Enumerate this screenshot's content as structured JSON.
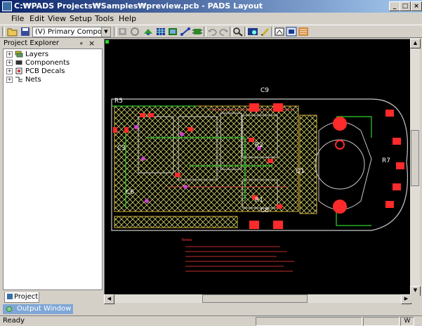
{
  "window": {
    "title": "C:₩PADS Projects₩Samples₩preview.pcb - PADS Layout",
    "controls": {
      "minimize": "_",
      "maximize": "□",
      "close": "×"
    }
  },
  "menu": [
    "File",
    "Edit",
    "View",
    "Setup",
    "Tools",
    "Help"
  ],
  "toolbar": {
    "mode_select": "(V) Primary Componen",
    "icons": [
      "open-icon",
      "save-icon",
      "select-mode-icon",
      "refresh-icon",
      "pan-icon",
      "grid-icon",
      "components-icon",
      "route-icon",
      "drc-icon",
      "undo-icon",
      "redo-icon",
      "zoom-icon",
      "view-icon",
      "highlight-icon",
      "cam-icon",
      "board-icon",
      "window-icon"
    ]
  },
  "explorer": {
    "title": "Project Explorer",
    "pin": "ᵩ",
    "close": "×",
    "items": [
      {
        "label": "Layers",
        "icon": "layers-icon"
      },
      {
        "label": "Components",
        "icon": "components-icon"
      },
      {
        "label": "PCB Decals",
        "icon": "decals-icon"
      },
      {
        "label": "Nets",
        "icon": "nets-icon"
      }
    ],
    "tab": "Project"
  },
  "canvas": {
    "labels": [
      "R5",
      "C9",
      "C3",
      "R2",
      "C6",
      "R1",
      "C8",
      "R7",
      "Q1"
    ],
    "notes_heading": "Notes"
  },
  "output_window": {
    "label": "Output Window"
  },
  "status": {
    "text": "Ready",
    "indicator": "W"
  },
  "colors": {
    "copper": "#d4b23a",
    "board_outline": "#c8c8c8",
    "pads": "#ff2a2a",
    "hatch": "#cfcf6a",
    "traces": "#2fd02f"
  }
}
